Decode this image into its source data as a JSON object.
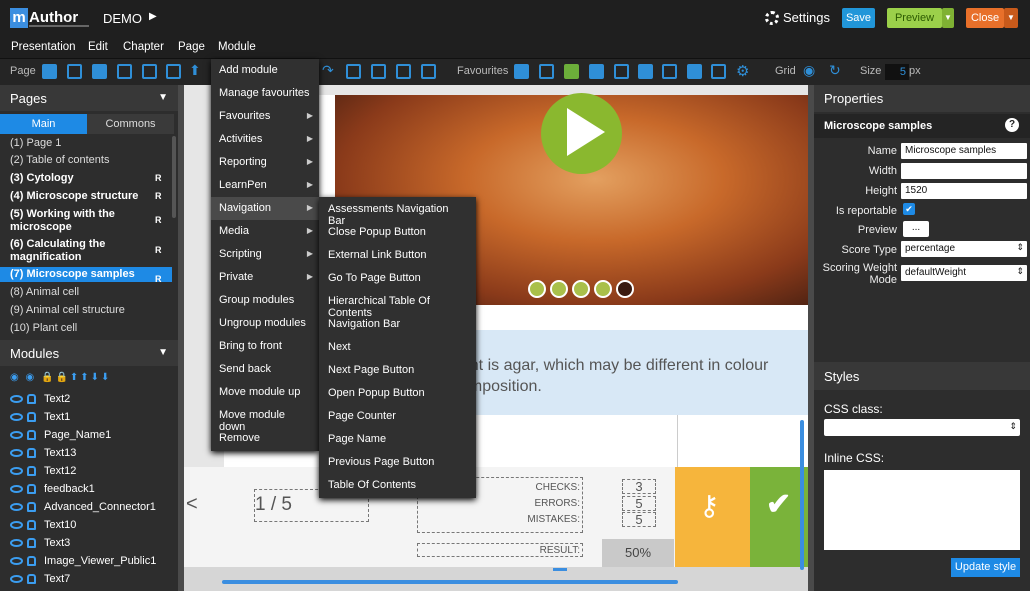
{
  "app": {
    "logo_m": "m",
    "logo_rest": "Author",
    "project": "DEMO",
    "play_icon": "play-icon"
  },
  "top": {
    "settings": "Settings",
    "save": "Save",
    "preview": "Preview",
    "close": "Close"
  },
  "menubar": [
    "Presentation",
    "Edit",
    "Chapter",
    "Page",
    "Module"
  ],
  "toolbar": {
    "page_label": "Page",
    "favourites_label": "Favourites",
    "grid_label": "Grid",
    "size_label": "Size",
    "size_value": "5",
    "size_unit": "px"
  },
  "pages_panel": {
    "title": "Pages",
    "tabs": [
      "Main",
      "Commons"
    ],
    "items": [
      {
        "label": "(1) Page 1",
        "r": ""
      },
      {
        "label": "(2) Table of contents",
        "r": ""
      },
      {
        "label": "(3) Cytology",
        "r": "R"
      },
      {
        "label": "(4) Microscope structure",
        "r": "R"
      },
      {
        "label": "(5) Working with the microscope",
        "r": "R"
      },
      {
        "label": "(6) Calculating the magnification",
        "r": "R"
      },
      {
        "label": "(7) Microscope samples",
        "r": "R"
      },
      {
        "label": "(8) Animal cell",
        "r": ""
      },
      {
        "label": "(9) Animal cell structure",
        "r": ""
      },
      {
        "label": "(10) Plant cell",
        "r": ""
      }
    ]
  },
  "modules_panel": {
    "title": "Modules",
    "items": [
      "Text2",
      "Text1",
      "Page_Name1",
      "Text13",
      "Text12",
      "feedback1",
      "Advanced_Connector1",
      "Text10",
      "Text3",
      "Image_Viewer_Public1",
      "Text7"
    ]
  },
  "context_menu": [
    {
      "label": "Add module",
      "sub": false
    },
    {
      "label": "Manage favourites",
      "sub": false
    },
    {
      "label": "Favourites",
      "sub": true
    },
    {
      "label": "Activities",
      "sub": true
    },
    {
      "label": "Reporting",
      "sub": true
    },
    {
      "label": "LearnPen",
      "sub": true
    },
    {
      "label": "Navigation",
      "sub": true
    },
    {
      "label": "Media",
      "sub": true
    },
    {
      "label": "Scripting",
      "sub": true
    },
    {
      "label": "Private",
      "sub": true
    },
    {
      "label": "Group modules",
      "sub": false
    },
    {
      "label": "Ungroup modules",
      "sub": false
    },
    {
      "label": "Bring to front",
      "sub": false
    },
    {
      "label": "Send back",
      "sub": false
    },
    {
      "label": "Move module up",
      "sub": false
    },
    {
      "label": "Move module down",
      "sub": false
    },
    {
      "label": "Remove",
      "sub": false
    }
  ],
  "navigation_submenu": [
    "Assessments Navigation Bar",
    "Close Popup Button",
    "External Link Button",
    "Go To Page Button",
    "Hierarchical Table Of Contents",
    "Navigation Bar",
    "Next",
    "Next Page Button",
    "Open Popup Button",
    "Page Counter",
    "Page Name",
    "Previous Page Button",
    "Table Of Contents"
  ],
  "canvas": {
    "text_line1": "rient is agar, which may be different in colour",
    "text_line2": "composition.",
    "page_counter": "1 / 5",
    "checks_label": "CHECKS:",
    "errors_label": "ERRORS:",
    "mistakes_label": "MISTAKES:",
    "result_label": "RESULT:",
    "checks": "3",
    "errors": "5",
    "mistakes": "5",
    "result": "50%",
    "prev_arrow": "<"
  },
  "properties": {
    "title": "Properties",
    "module_name": "Microscope samples",
    "help": "?",
    "fields": [
      {
        "label": "Name",
        "value": "Microscope samples"
      },
      {
        "label": "Width",
        "value": ""
      },
      {
        "label": "Height",
        "value": "1520"
      },
      {
        "label": "Is reportable",
        "value": ""
      },
      {
        "label": "Preview",
        "value": "..."
      },
      {
        "label": "Score Type",
        "value": "percentage"
      },
      {
        "label": "Scoring Weight Mode",
        "value": "defaultWeight"
      }
    ]
  },
  "styles": {
    "title": "Styles",
    "css_class_label": "CSS class:",
    "inline_css_label": "Inline CSS:",
    "update_button": "Update style"
  },
  "colors": {
    "accent": "#1e8ae5",
    "save": "#2196d9",
    "preview": "#9bd04a",
    "close": "#e8702a",
    "key": "#f6b53c",
    "check": "#7ab33a"
  }
}
